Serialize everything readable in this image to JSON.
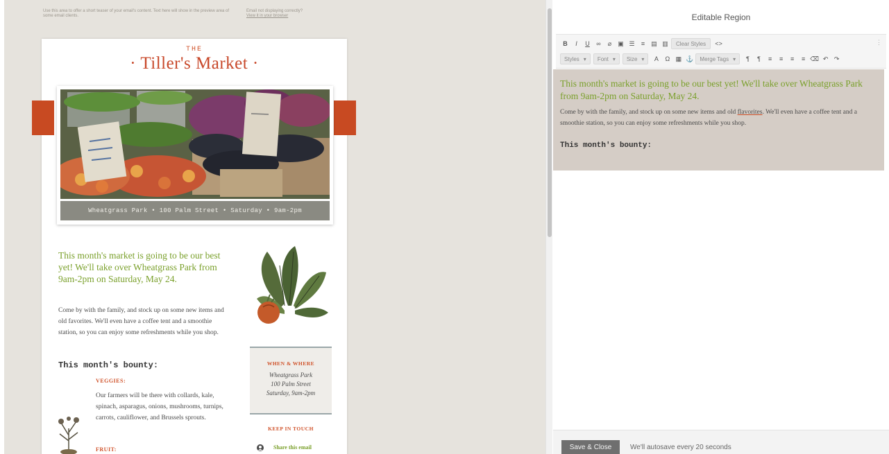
{
  "preview": {
    "preheader_left": "Use this area to offer a short teaser of your email's content. Text here will show in the preview area of some email clients.",
    "preheader_right_line1": "Email not displaying correctly?",
    "preheader_right_line2": "View it in your browser",
    "logo_the": "THE",
    "logo_title": "· Tiller's Market ·",
    "photo_caption": "Wheatgrass Park • 100 Palm Street • Saturday • 9am-2pm",
    "intro_heading": "This month's market is going to be our best yet! We'll take over Wheatgrass Park from 9am-2pm on Saturday, May 24.",
    "intro_body": "Come by with the family, and stock up on some new items and old favorites. We'll even have a coffee tent and a smoothie station, so you can enjoy some refreshments while you shop.",
    "bounty_heading": "This month's bounty:",
    "veggies_label": "VEGGIES:",
    "veggies_text": "Our farmers will be there with collards, kale, spinach, asparagus, onions, mushrooms, turnips, carrots, cauliflower, and Brussels sprouts.",
    "fruit_label": "FRUIT:",
    "when_where_label": "WHEN & WHERE",
    "when_where_line1": "Wheatgrass Park",
    "when_where_line2": "100 Palm Street",
    "when_where_line3": "Saturday, 9am-2pm",
    "keep_in_touch_label": "KEEP IN TOUCH",
    "share_label": "Share this email"
  },
  "editor": {
    "title": "Editable Region",
    "toolbar": {
      "bold": "B",
      "italic": "I",
      "underline": "U",
      "clear_styles": "Clear Styles",
      "source": "<>",
      "styles": "Styles",
      "font": "Font",
      "size": "Size",
      "merge_tags": "Merge Tags"
    },
    "content": {
      "heading": "This month's market is going to be our best yet! We'll take over Wheatgrass Park from 9am-2pm on Saturday, May 24.",
      "body_part1": "Come by with the family, and stock up on some new items and old ",
      "body_spell": "flavorites",
      "body_part2": ". We'll even have a coffee tent and a smoothie station, so you can enjoy some refreshments while you shop.",
      "bounty": "This month's bounty:"
    },
    "footer": {
      "save_button": "Save & Close",
      "autosave_text": "We'll autosave every 20 seconds"
    }
  },
  "colors": {
    "brand_red": "#c8482a",
    "accent_green": "#7aa02b",
    "edit_bg": "#d5cdc6",
    "button_gray": "#6f6f6f"
  }
}
